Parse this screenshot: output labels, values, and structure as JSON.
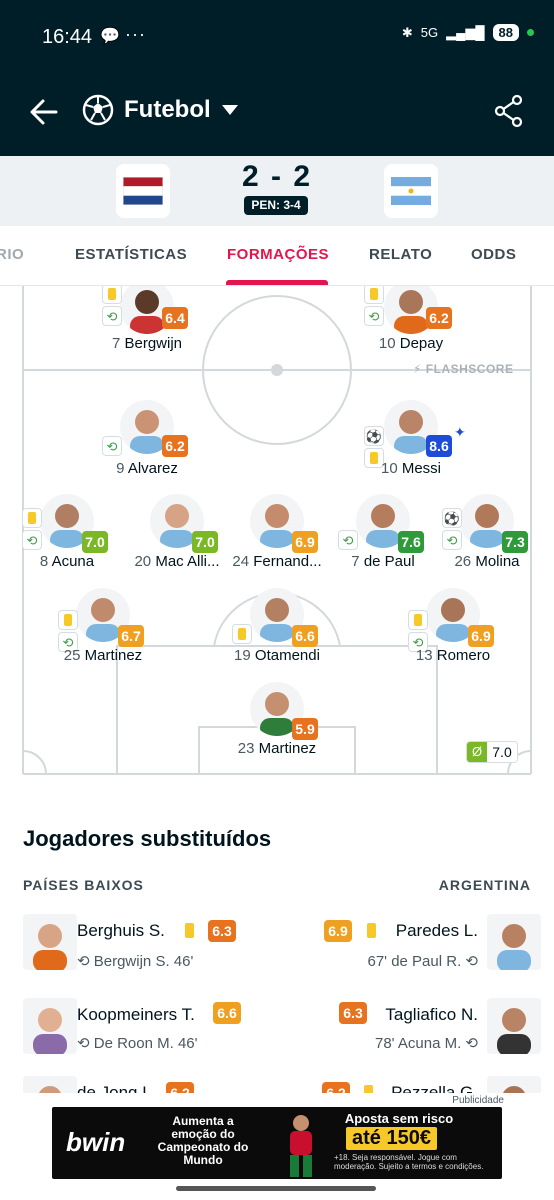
{
  "status_bar": {
    "time": "16:44",
    "network": "5G",
    "battery": "88"
  },
  "app_bar": {
    "sport": "Futebol"
  },
  "match": {
    "score": "2 - 2",
    "penalties": "PEN: 3-4"
  },
  "tabs": [
    {
      "label": "RIO"
    },
    {
      "label": "ESTATÍSTICAS"
    },
    {
      "label": "FORMAÇÕES"
    },
    {
      "label": "RELATO"
    },
    {
      "label": "ODDS"
    }
  ],
  "pitch": {
    "watermark": "FLASHSCORE",
    "players": [
      {
        "number": "7",
        "name": "Bergwijn",
        "rating": "6.4"
      },
      {
        "number": "10",
        "name": "Depay",
        "rating": "6.2"
      },
      {
        "number": "9",
        "name": "Alvarez",
        "rating": "6.2"
      },
      {
        "number": "10",
        "name": "Messi",
        "rating": "8.6"
      },
      {
        "number": "8",
        "name": "Acuna",
        "rating": "7.0"
      },
      {
        "number": "20",
        "name": "Mac Alli...",
        "rating": "7.0"
      },
      {
        "number": "24",
        "name": "Fernand...",
        "rating": "6.9"
      },
      {
        "number": "7",
        "name": "de Paul",
        "rating": "7.6"
      },
      {
        "number": "26",
        "name": "Molina",
        "rating": "7.3"
      },
      {
        "number": "25",
        "name": "Martinez",
        "rating": "6.7"
      },
      {
        "number": "19",
        "name": "Otamendi",
        "rating": "6.6"
      },
      {
        "number": "13",
        "name": "Romero",
        "rating": "6.9"
      },
      {
        "number": "23",
        "name": "Martinez",
        "rating": "5.9"
      }
    ],
    "coach_rating": "7.0"
  },
  "substitutes": {
    "title": "Jogadores substituídos",
    "home_team": "PAÍSES BAIXOS",
    "away_team": "ARGENTINA",
    "home": [
      {
        "name": "Berghuis S.",
        "rating": "6.3",
        "replaced": "Bergwijn S. 46'"
      },
      {
        "name": "Koopmeiners T.",
        "rating": "6.6",
        "replaced": "De Roon M. 46'"
      },
      {
        "name": "de Jong L.",
        "rating": "6.2",
        "replaced": ""
      }
    ],
    "away": [
      {
        "name": "Paredes L.",
        "rating": "6.9",
        "replaced": "67' de Paul R."
      },
      {
        "name": "Tagliafico N.",
        "rating": "6.3",
        "replaced": "78' Acuna M."
      },
      {
        "name": "Pezzella G.",
        "rating": "6.2",
        "replaced": ""
      }
    ]
  },
  "ad": {
    "label": "Publicidade",
    "brand": "bwin",
    "headline": "Aumenta a emoção do Campeonato do Mundo",
    "offer": "Aposta sem risco",
    "amount": "até 150€",
    "fine_print": "+18. Seja responsável. Jogue com moderação. Sujeito a termos e condições."
  },
  "colors": {
    "header": "#001e28",
    "accent": "#e4144e",
    "rating_orange": "#e8731f",
    "rating_green": "#2e9a3a",
    "rating_blue": "#1d4cd8"
  }
}
